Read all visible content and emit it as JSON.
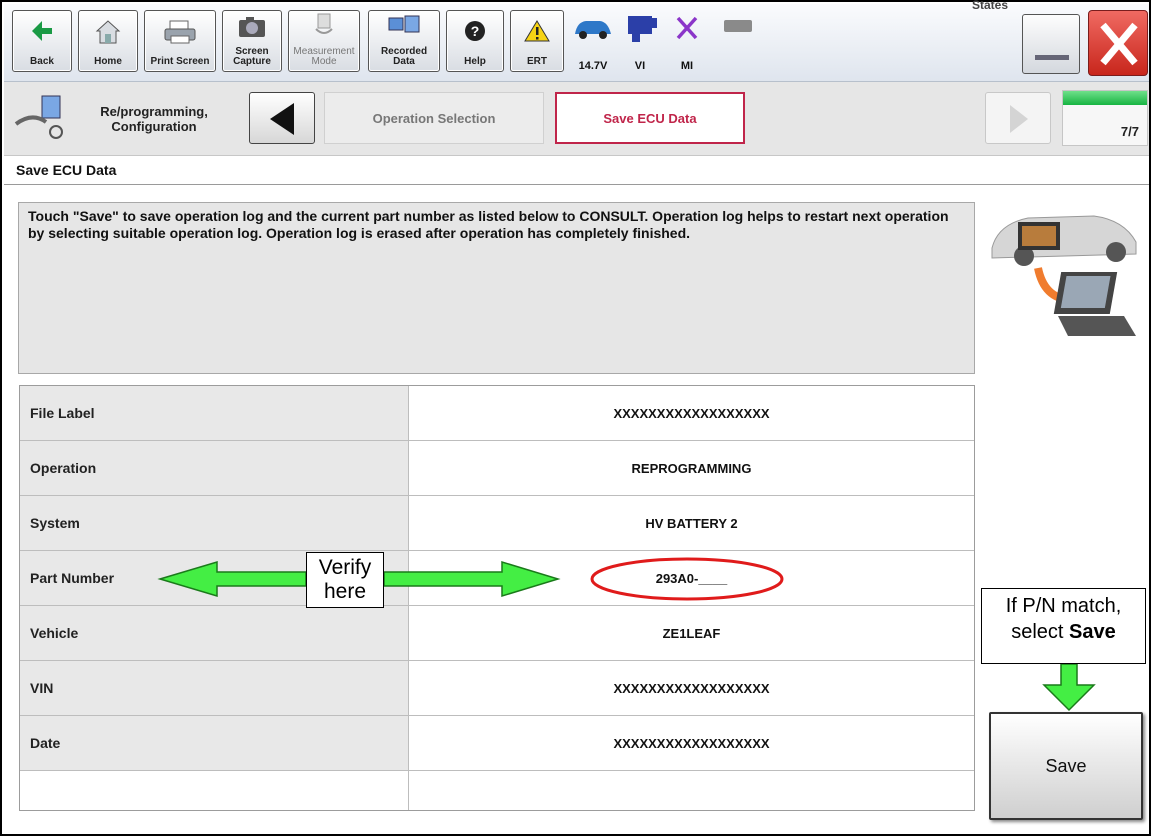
{
  "toolbar": {
    "buttons": [
      {
        "label": "Back"
      },
      {
        "label": "Home"
      },
      {
        "label": "Print Screen"
      },
      {
        "label": "Screen Capture"
      },
      {
        "label": "Measurement Mode"
      },
      {
        "label": "Recorded Data"
      },
      {
        "label": "Help"
      },
      {
        "label": "ERT"
      }
    ],
    "status": {
      "voltage": "14.7V",
      "vi": "VI",
      "mi": "MI",
      "header": "States"
    }
  },
  "nav": {
    "title": "Re/programming, Configuration",
    "crumbs": [
      "Operation Selection",
      "Save ECU Data"
    ],
    "progress_text": "7/7",
    "progress_fraction": 1.0
  },
  "section_title": "Save ECU Data",
  "message": "Touch \"Save\" to save operation log and the current part number as listed below to CONSULT. Operation log helps to restart next operation by selecting suitable operation log. Operation log is erased after operation has completely finished.",
  "table": {
    "rows": [
      {
        "key": "File Label",
        "value": "XXXXXXXXXXXXXXXXXX"
      },
      {
        "key": "Operation",
        "value": "REPROGRAMMING"
      },
      {
        "key": "System",
        "value": "HV BATTERY 2"
      },
      {
        "key": "Part Number",
        "value": "293A0-____"
      },
      {
        "key": "Vehicle",
        "value": "ZE1LEAF"
      },
      {
        "key": "VIN",
        "value": "XXXXXXXXXXXXXXXXXX"
      },
      {
        "key": "Date",
        "value": "XXXXXXXXXXXXXXXXXX"
      }
    ]
  },
  "annotations": {
    "verify": [
      "Verify",
      "here"
    ],
    "pn_match_line1": "If P/N match,",
    "pn_match_line2_prefix": "select ",
    "pn_match_line2_bold": "Save"
  },
  "save_label": "Save",
  "colors": {
    "accent_red": "#c0254a",
    "arrow_green": "#44ee44",
    "ellipse_red": "#e01b1b"
  }
}
